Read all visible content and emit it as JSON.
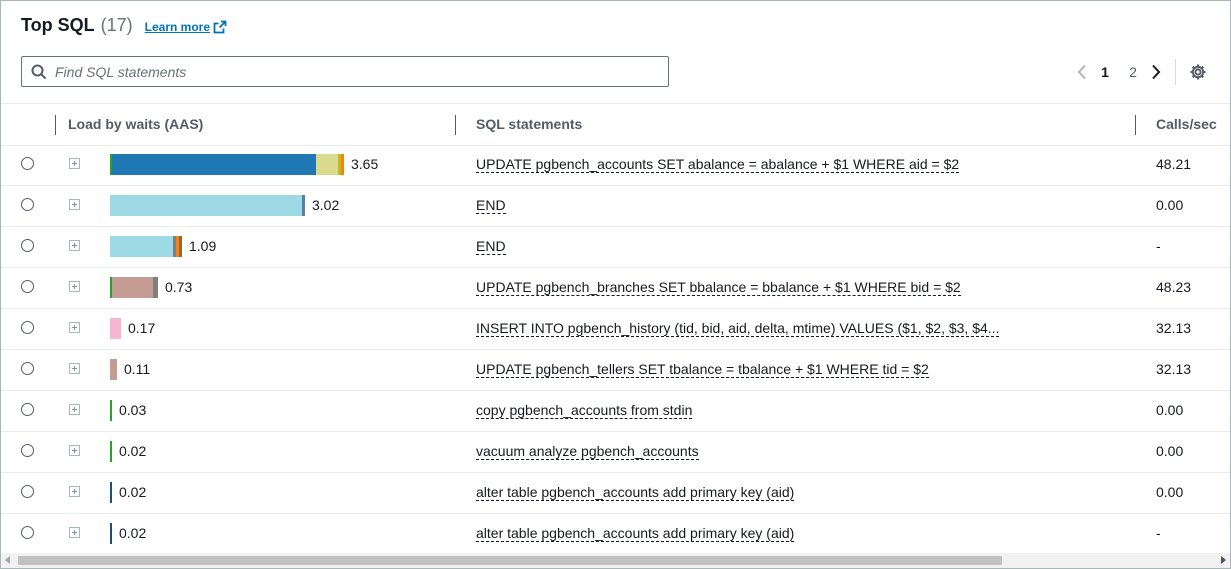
{
  "header": {
    "title": "Top SQL",
    "count": "(17)",
    "learn_more": "Learn more"
  },
  "search": {
    "placeholder": "Find SQL statements"
  },
  "pagination": {
    "pages": [
      "1",
      "2"
    ],
    "current": "1"
  },
  "columns": {
    "load": "Load by waits (AAS)",
    "sql": "SQL statements",
    "calls": "Calls/sec"
  },
  "colors": {
    "cpu": "#1f77b4",
    "io_light": "#9edae5",
    "lock": "#c49c94",
    "pink": "#f7b6d2",
    "green": "#2ca02c",
    "gray": "#7f7f7f",
    "olive": "#dbdb8d",
    "orange": "#ff7f0e"
  },
  "rows": [
    {
      "value": "3.65",
      "sql": "UPDATE pgbench_accounts SET abalance = abalance + $1 WHERE aid = $2",
      "calls": "48.21",
      "segments": [
        {
          "color": "#2ca02c",
          "aas": 0.03
        },
        {
          "color": "#1f77b4",
          "aas": 3.14
        },
        {
          "color": "#dbdb8d",
          "aas": 0.34
        },
        {
          "color": "#bcbd22",
          "aas": 0.04
        },
        {
          "color": "#ff7f0e",
          "aas": 0.04
        }
      ]
    },
    {
      "value": "3.02",
      "sql": "END",
      "calls": "0.00",
      "segments": [
        {
          "color": "#9edae5",
          "aas": 2.95
        },
        {
          "color": "#5a7ea6",
          "aas": 0.05
        }
      ]
    },
    {
      "value": "1.09",
      "sql": "END",
      "calls": "-",
      "segments": [
        {
          "color": "#9edae5",
          "aas": 0.97
        },
        {
          "color": "#7f7f7f",
          "aas": 0.04
        },
        {
          "color": "#ff7f0e",
          "aas": 0.04
        },
        {
          "color": "#8c6d31",
          "aas": 0.04
        }
      ]
    },
    {
      "value": "0.73",
      "sql": "UPDATE pgbench_branches SET bbalance = bbalance + $1 WHERE bid = $2",
      "calls": "48.23",
      "segments": [
        {
          "color": "#2ca02c",
          "aas": 0.02
        },
        {
          "color": "#c49c94",
          "aas": 0.63
        },
        {
          "color": "#7f7f7f",
          "aas": 0.08
        }
      ]
    },
    {
      "value": "0.17",
      "sql": "INSERT INTO pgbench_history (tid, bid, aid, delta, mtime) VALUES ($1, $2, $3, $4...",
      "calls": "32.13",
      "segments": [
        {
          "color": "#f7b6d2",
          "aas": 0.17
        }
      ]
    },
    {
      "value": "0.11",
      "sql": "UPDATE pgbench_tellers SET tbalance = tbalance + $1 WHERE tid = $2",
      "calls": "32.13",
      "segments": [
        {
          "color": "#c49c94",
          "aas": 0.11
        }
      ]
    },
    {
      "value": "0.03",
      "sql": "copy pgbench_accounts from stdin",
      "calls": "0.00",
      "segments": [
        {
          "color": "#2ca02c",
          "aas": 0.03
        }
      ]
    },
    {
      "value": "0.02",
      "sql": "vacuum analyze pgbench_accounts",
      "calls": "0.00",
      "segments": [
        {
          "color": "#2ca02c",
          "aas": 0.02
        }
      ]
    },
    {
      "value": "0.02",
      "sql": "alter table pgbench_accounts add primary key (aid)",
      "calls": "0.00",
      "segments": [
        {
          "color": "#1f4e79",
          "aas": 0.02
        }
      ]
    },
    {
      "value": "0.02",
      "sql": "alter table pgbench_accounts add primary key (aid)",
      "calls": "-",
      "segments": [
        {
          "color": "#1f4e79",
          "aas": 0.02
        }
      ]
    }
  ]
}
